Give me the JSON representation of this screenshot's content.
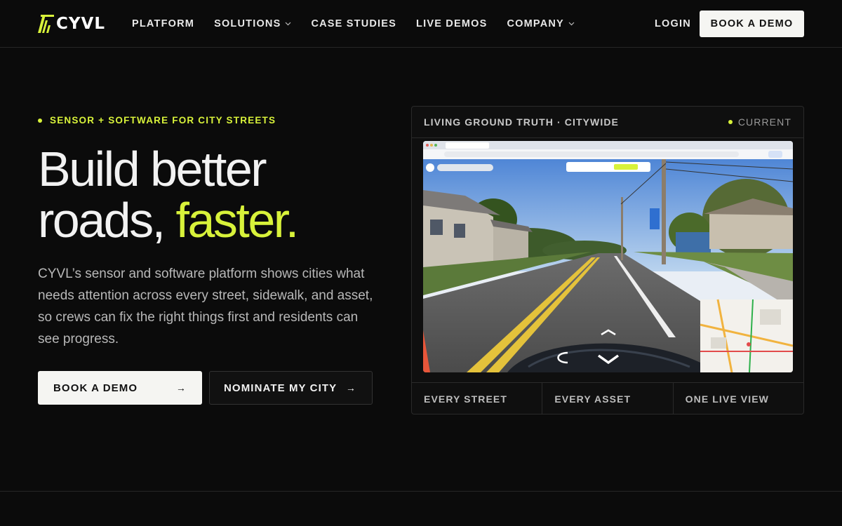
{
  "brand": {
    "name": "CYVL",
    "accent": "#d8f23a"
  },
  "nav": {
    "links": [
      {
        "label": "PLATFORM",
        "dropdown": false
      },
      {
        "label": "SOLUTIONS",
        "dropdown": true
      },
      {
        "label": "CASE STUDIES",
        "dropdown": false
      },
      {
        "label": "LIVE DEMOS",
        "dropdown": false
      },
      {
        "label": "COMPANY",
        "dropdown": true
      }
    ],
    "login": "LOGIN",
    "cta": "BOOK A DEMO"
  },
  "hero": {
    "eyebrow": "SENSOR + SOFTWARE FOR CITY STREETS",
    "headline_line1": "Build better",
    "headline_line2a": "roads, ",
    "headline_line2b": "faster.",
    "description": "CYVL’s sensor and software platform shows cities what needs attention across every street, sidewalk, and asset, so crews can fix the right things first and residents can see progress.",
    "primary_button": "BOOK A DEMO",
    "secondary_button": "NOMINATE MY CITY"
  },
  "panel": {
    "title": "LIVING GROUND TRUTH · CITYWIDE",
    "status": "CURRENT",
    "footer": [
      "EVERY STREET",
      "EVERY ASSET",
      "ONE LIVE VIEW"
    ]
  }
}
